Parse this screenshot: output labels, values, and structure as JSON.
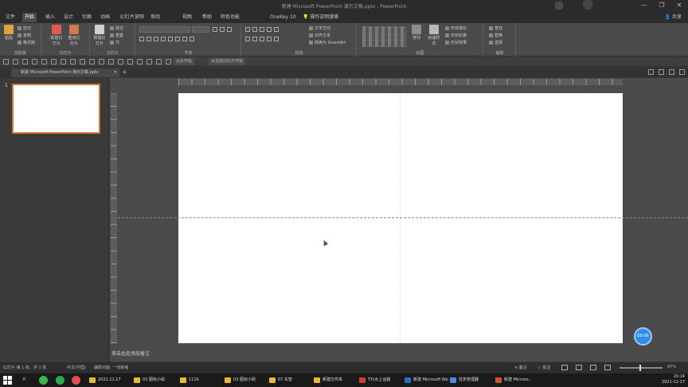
{
  "window": {
    "title": "新建 Microsoft PowerPoint 演示文稿.pptx - PowerPoint",
    "controls": [
      "—",
      "❐",
      "✕"
    ]
  },
  "ribbon_tabs": [
    {
      "label": "文件"
    },
    {
      "label": "开始"
    },
    {
      "label": "插入"
    },
    {
      "label": "设计"
    },
    {
      "label": "切换"
    },
    {
      "label": "动画"
    },
    {
      "label": "幻灯片放映"
    },
    {
      "label": "审阅"
    },
    {
      "label": "视图"
    },
    {
      "label": "帮助"
    },
    {
      "label": "特色功能"
    },
    {
      "label": "OneKey 10"
    }
  ],
  "active_tab": "开始",
  "tell_me": "操作说明搜索",
  "share": "共享",
  "ribbon": {
    "clipboard": {
      "paste": "粘贴",
      "cut": "剪切",
      "copy": "复制",
      "format_painter": "格式刷",
      "label": "剪贴板"
    },
    "slides": {
      "new_slide": "新建幻灯片",
      "reuse": "重用幻灯片",
      "layout": "版式",
      "reset": "重置",
      "section": "节",
      "label": "幻灯片"
    },
    "font": {
      "label": "字体"
    },
    "paragraph": {
      "label": "段落",
      "text_direction": "文字方向",
      "align_text": "对齐文本",
      "smartart": "转换为 SmartArt"
    },
    "drawing": {
      "label": "绘图",
      "arrange": "排列",
      "quick_styles": "快速样式",
      "shape_fill": "形状填充",
      "shape_outline": "形状轮廓",
      "shape_effects": "形状效果"
    },
    "editing": {
      "label": "编辑",
      "find": "查找",
      "replace": "替换",
      "select": "选择"
    }
  },
  "qat": {
    "label": "从头开始",
    "label2": "从当前幻灯片开始"
  },
  "doc_tab": {
    "label": "新建 Microsoft PowerPoint 演示文稿.pptx",
    "close": "✕"
  },
  "thumbnails": [
    {
      "number": "1"
    }
  ],
  "notes_placeholder": "单击此处添加备注",
  "timer_badge": "00:06",
  "status": {
    "slide_info": "幻灯片 第 1 张，共 1 张",
    "language": "中文(中国)",
    "accessibility": "辅助功能: 一切就绪",
    "notes": "备注",
    "comments": "批注",
    "zoom": "67%"
  },
  "taskbar": {
    "items": [
      {
        "label": "2021.11.17",
        "color": "#e8b839"
      },
      {
        "label": "03 图标小助",
        "color": "#e8b839"
      },
      {
        "label": "1116",
        "color": "#e8b839"
      },
      {
        "label": "03 图标小助",
        "color": "#e8b839"
      },
      {
        "label": "07 东智",
        "color": "#e8b839"
      },
      {
        "label": "新建文件夹",
        "color": "#e8b839"
      },
      {
        "label": "TX(水上运输",
        "color": "#d23a3a"
      },
      {
        "label": "新建 Microsoft Wo",
        "color": "#2b6cc4"
      },
      {
        "label": "任务管理器",
        "color": "#4a8ad9"
      },
      {
        "label": "新建 Microso...",
        "color": "#d0532d"
      }
    ],
    "clock_time": "20:14",
    "clock_date": "2021-11-17"
  },
  "colors": {
    "slide_bg": "#ffffff",
    "app_bg": "#4b4b4b",
    "thumb_border": "#d3743f",
    "timer": "#2f8fe5"
  }
}
